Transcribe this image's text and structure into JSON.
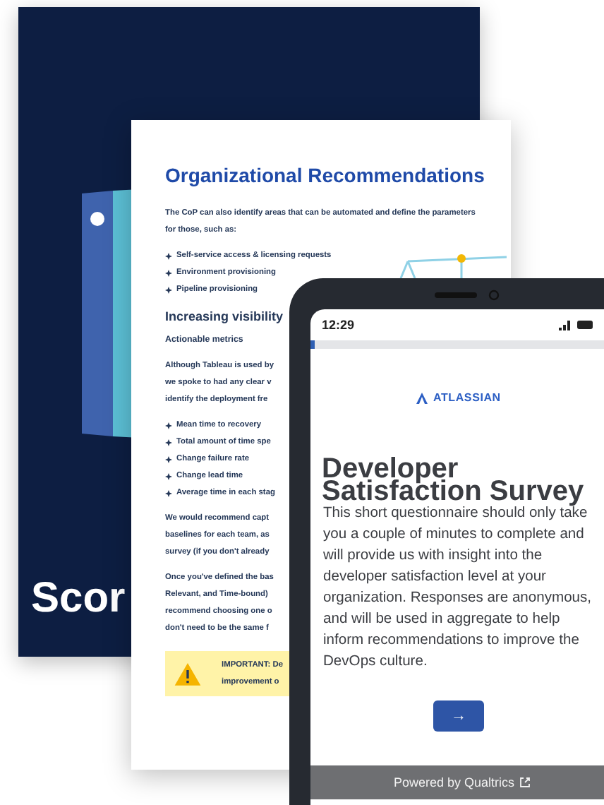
{
  "cover": {
    "title": "Scor"
  },
  "document": {
    "heading": "Organizational Recommendations",
    "intro_lines": [
      "The CoP can also identify areas that can be automated and define the parameters",
      "for those, such as:"
    ],
    "bullets_1": [
      "Self-service access & licensing requests",
      "Environment provisioning",
      "Pipeline provisioning"
    ],
    "subheading": "Increasing visibility",
    "label": "Actionable metrics",
    "paragraph_1": [
      "Although Tableau is used by",
      "we spoke to had any clear v",
      "identify the deployment fre"
    ],
    "bullets_2": [
      "Mean time to recovery",
      "Total amount of time spe",
      "Change failure rate",
      "Change lead time",
      "Average time in each stag"
    ],
    "paragraph_2": [
      "We would recommend capt",
      "baselines for each team, as",
      "survey (if you don't already"
    ],
    "paragraph_3": [
      "Once you've defined the bas",
      "Relevant, and Time-bound) ",
      "recommend choosing one o",
      "don't need to be the same f"
    ],
    "callout": [
      "**IMPORTANT:** De",
      "improvement o"
    ]
  },
  "phone": {
    "time": "12:29",
    "logo": "ATLASSIAN",
    "title": "Developer Satisfaction Survey",
    "body": "This short questionnaire should only take you a couple of minutes to complete and will provide us with insight into the developer satisfaction level at your organization. Responses are anonymous, and will be used in aggregate to help inform recommendations to improve the DevOps culture.",
    "next_button": "→",
    "footer": "Powered by Qualtrics"
  }
}
